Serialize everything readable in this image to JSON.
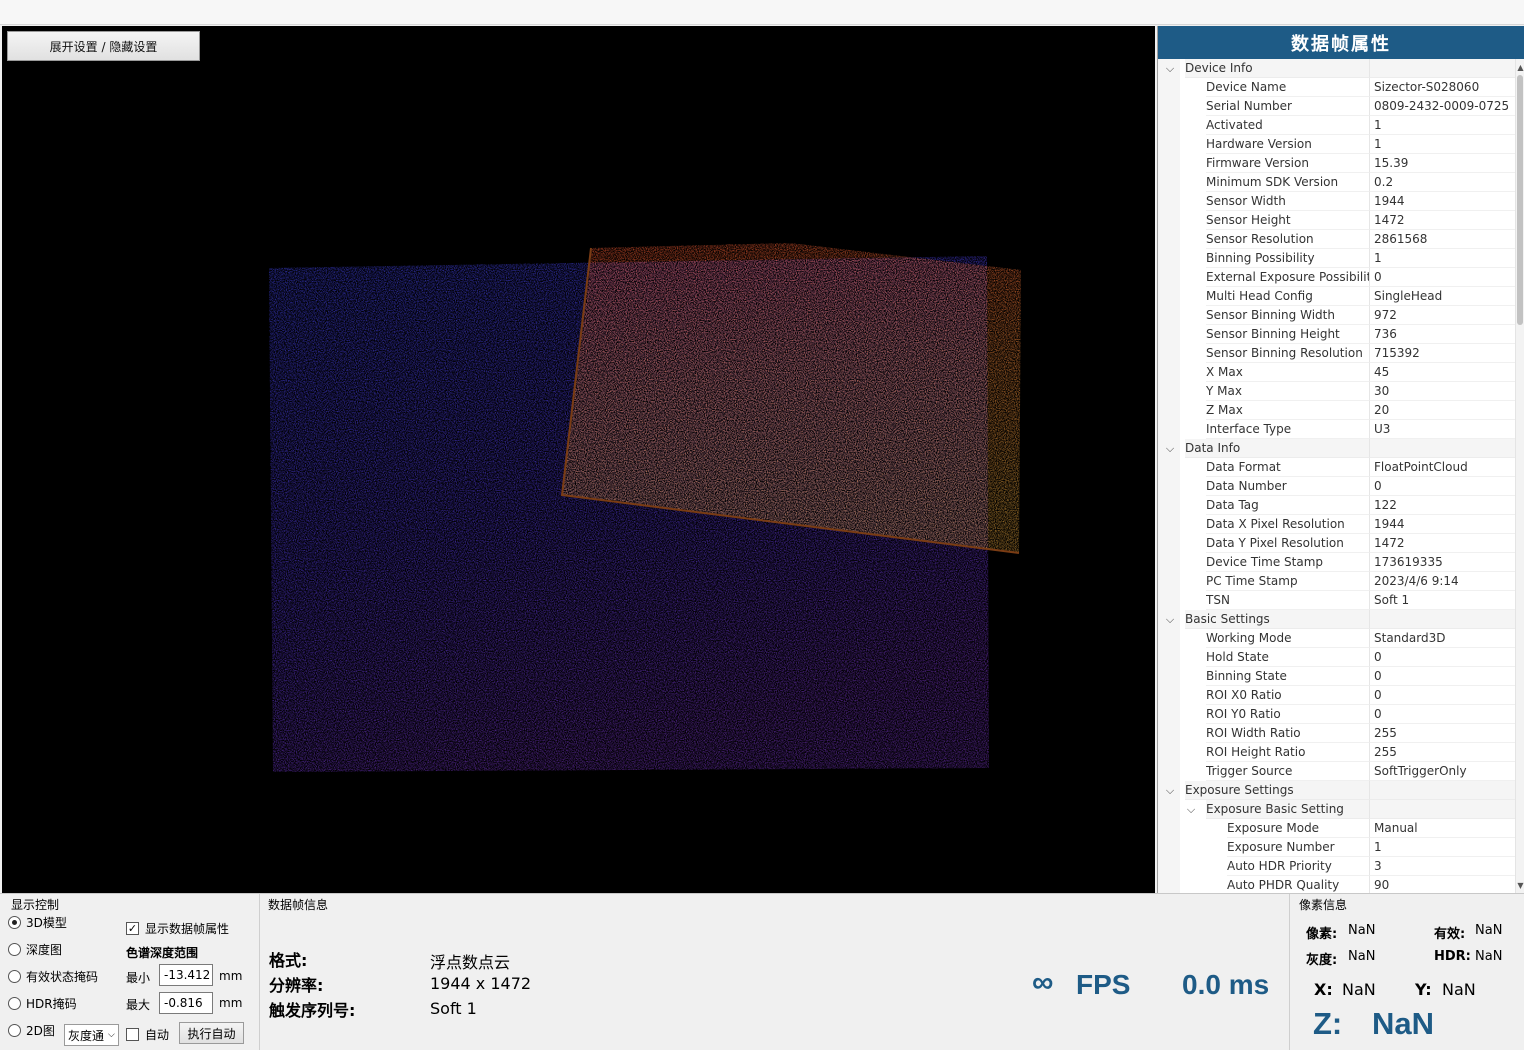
{
  "toggle_label": "展开设置 / 隐藏设置",
  "props": {
    "title": "数据帧属性",
    "rows": [
      {
        "type": "cat",
        "level": 0,
        "name": "Device Info"
      },
      {
        "type": "item",
        "level": 1,
        "name": "Device Name",
        "value": "Sizector-S028060"
      },
      {
        "type": "item",
        "level": 1,
        "name": "Serial Number",
        "value": "0809-2432-0009-0725"
      },
      {
        "type": "item",
        "level": 1,
        "name": "Activated",
        "value": "1"
      },
      {
        "type": "item",
        "level": 1,
        "name": "Hardware Version",
        "value": "1"
      },
      {
        "type": "item",
        "level": 1,
        "name": "Firmware Version",
        "value": "15.39"
      },
      {
        "type": "item",
        "level": 1,
        "name": "Minimum SDK Version",
        "value": "0.2"
      },
      {
        "type": "item",
        "level": 1,
        "name": "Sensor Width",
        "value": "1944"
      },
      {
        "type": "item",
        "level": 1,
        "name": "Sensor Height",
        "value": "1472"
      },
      {
        "type": "item",
        "level": 1,
        "name": "Sensor Resolution",
        "value": "2861568"
      },
      {
        "type": "item",
        "level": 1,
        "name": "Binning Possibility",
        "value": "1"
      },
      {
        "type": "item",
        "level": 1,
        "name": "External Exposure Possibility",
        "value": "0"
      },
      {
        "type": "item",
        "level": 1,
        "name": "Multi Head Config",
        "value": "SingleHead"
      },
      {
        "type": "item",
        "level": 1,
        "name": "Sensor Binning Width",
        "value": "972"
      },
      {
        "type": "item",
        "level": 1,
        "name": "Sensor Binning Height",
        "value": "736"
      },
      {
        "type": "item",
        "level": 1,
        "name": "Sensor Binning Resolution",
        "value": "715392"
      },
      {
        "type": "item",
        "level": 1,
        "name": "X Max",
        "value": "45"
      },
      {
        "type": "item",
        "level": 1,
        "name": "Y Max",
        "value": "30"
      },
      {
        "type": "item",
        "level": 1,
        "name": "Z Max",
        "value": "20"
      },
      {
        "type": "item",
        "level": 1,
        "name": "Interface Type",
        "value": "U3"
      },
      {
        "type": "cat",
        "level": 0,
        "name": "Data Info"
      },
      {
        "type": "item",
        "level": 1,
        "name": "Data Format",
        "value": "FloatPointCloud"
      },
      {
        "type": "item",
        "level": 1,
        "name": "Data Number",
        "value": "0"
      },
      {
        "type": "item",
        "level": 1,
        "name": "Data Tag",
        "value": "122"
      },
      {
        "type": "item",
        "level": 1,
        "name": "Data X Pixel Resolution",
        "value": "1944"
      },
      {
        "type": "item",
        "level": 1,
        "name": "Data Y Pixel Resolution",
        "value": "1472"
      },
      {
        "type": "item",
        "level": 1,
        "name": "Device Time Stamp",
        "value": "173619335"
      },
      {
        "type": "item",
        "level": 1,
        "name": "PC Time Stamp",
        "value": "2023/4/6 9:14"
      },
      {
        "type": "item",
        "level": 1,
        "name": "TSN",
        "value": "Soft 1"
      },
      {
        "type": "cat",
        "level": 0,
        "name": "Basic Settings"
      },
      {
        "type": "item",
        "level": 1,
        "name": "Working Mode",
        "value": "Standard3D"
      },
      {
        "type": "item",
        "level": 1,
        "name": "Hold State",
        "value": "0"
      },
      {
        "type": "item",
        "level": 1,
        "name": "Binning State",
        "value": "0"
      },
      {
        "type": "item",
        "level": 1,
        "name": "ROI X0 Ratio",
        "value": "0"
      },
      {
        "type": "item",
        "level": 1,
        "name": "ROI Y0 Ratio",
        "value": "0"
      },
      {
        "type": "item",
        "level": 1,
        "name": "ROI Width Ratio",
        "value": "255"
      },
      {
        "type": "item",
        "level": 1,
        "name": "ROI Height Ratio",
        "value": "255"
      },
      {
        "type": "item",
        "level": 1,
        "name": "Trigger Source",
        "value": "SoftTriggerOnly"
      },
      {
        "type": "cat",
        "level": 0,
        "name": "Exposure Settings"
      },
      {
        "type": "cat",
        "level": 1,
        "name": "Exposure Basic Setting"
      },
      {
        "type": "item",
        "level": 2,
        "name": "Exposure Mode",
        "value": "Manual"
      },
      {
        "type": "item",
        "level": 2,
        "name": "Exposure Number",
        "value": "1"
      },
      {
        "type": "item",
        "level": 2,
        "name": "Auto HDR Priority",
        "value": "3"
      },
      {
        "type": "item",
        "level": 2,
        "name": "Auto PHDR Quality",
        "value": "90"
      }
    ]
  },
  "display_control": {
    "title": "显示控制",
    "modes": [
      {
        "label": "3D模型",
        "selected": true
      },
      {
        "label": "深度图",
        "selected": false
      },
      {
        "label": "有效状态掩码",
        "selected": false
      },
      {
        "label": "HDR掩码",
        "selected": false
      },
      {
        "label": "2D图",
        "selected": false
      }
    ],
    "show_props_label": "显示数据帧属性",
    "show_props_checked": true,
    "range_title": "色谱深度范围",
    "min_label": "最小",
    "min_value": "-13.412",
    "max_label": "最大",
    "max_value": "-0.816",
    "unit": "mm",
    "gray_select": "灰度通",
    "auto_label": "自动",
    "auto_checked": false,
    "exec_auto_label": "执行自动"
  },
  "frame_info": {
    "title": "数据帧信息",
    "format_key": "格式:",
    "format_value": "浮点数点云",
    "res_key": "分辨率:",
    "res_value": "1944 x 1472",
    "tsn_key": "触发序列号:",
    "tsn_value": "Soft 1",
    "fps_symbol": "∞",
    "fps_label": "FPS",
    "latency": "0.0 ms"
  },
  "pixel_info": {
    "title": "像素信息",
    "pixel_key": "像素:",
    "pixel_val": "NaN",
    "valid_key": "有效:",
    "valid_val": "NaN",
    "gray_key": "灰度:",
    "gray_val": "NaN",
    "hdr_key": "HDR:",
    "hdr_val": "NaN",
    "x_key": "X:",
    "x_val": "NaN",
    "y_key": "Y:",
    "y_val": "NaN",
    "z_key": "Z:",
    "z_val": "NaN"
  },
  "colors": {
    "accent": "#1e5b86"
  }
}
